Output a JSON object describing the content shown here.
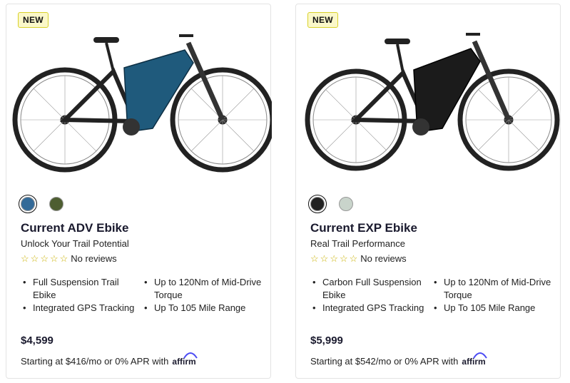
{
  "products": [
    {
      "badge": "NEW",
      "name": "Current ADV Ebike",
      "tagline": "Unlock Your Trail Potential",
      "reviews": "No reviews",
      "swatches": [
        "#336a98",
        "#4e5e31"
      ],
      "features": [
        "Full Suspension Trail Ebike",
        "Up to 120Nm of Mid-Drive Torque",
        "Integrated GPS Tracking",
        "Up To 105 Mile Range"
      ],
      "price": "$4,599",
      "financing": "Starting at $416/mo or 0% APR with",
      "affirm": "affirm",
      "frame_color": "#1f5a7c"
    },
    {
      "badge": "NEW",
      "name": "Current EXP Ebike",
      "tagline": "Real Trail Performance",
      "reviews": "No reviews",
      "swatches": [
        "#222222",
        "#c9d4cb"
      ],
      "features": [
        "Carbon Full Suspension Ebike",
        "Up to 120Nm of Mid-Drive Torque",
        "Integrated GPS Tracking",
        "Up To 105 Mile Range"
      ],
      "price": "$5,999",
      "financing": "Starting at $542/mo or 0% APR with",
      "affirm": "affirm",
      "frame_color": "#1b1b1b"
    }
  ]
}
